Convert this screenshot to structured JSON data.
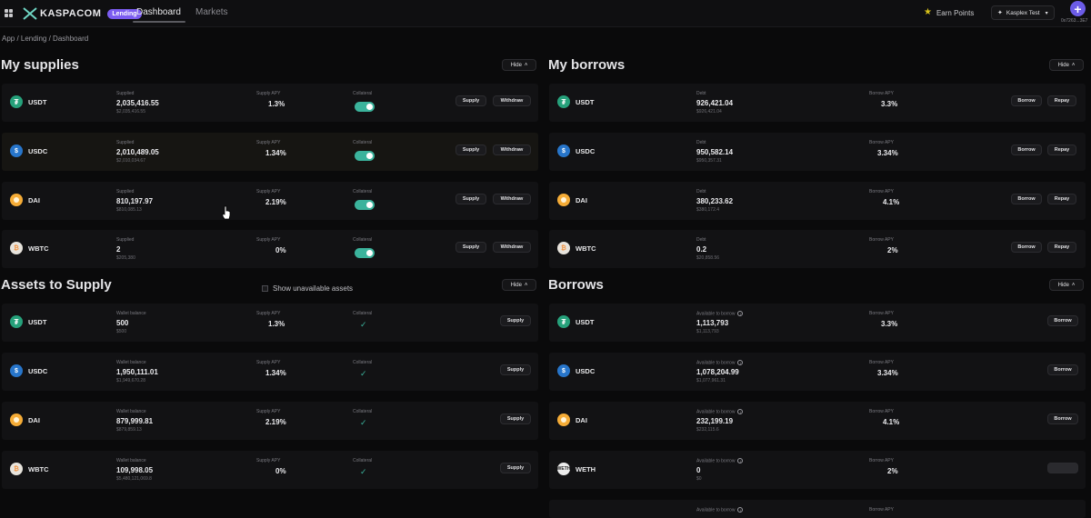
{
  "nav": {
    "brand": "KASPACOM",
    "badge": "Lending",
    "tabs": [
      {
        "label": "Dashboard"
      },
      {
        "label": "Markets"
      }
    ],
    "earn_label": "Earn Points",
    "wallet_label": "Kasplex Test",
    "address": "0x7263...3E7"
  },
  "breadcrumb": "App  /  Lending  /  Dashboard",
  "hide_label": "Hide",
  "supplies": {
    "title": "My supplies",
    "label_supplied": "Supplied",
    "label_apy": "Supply APY",
    "label_collateral": "Collateral",
    "supply_btn": "Supply",
    "withdraw_btn": "Withdraw",
    "rows": [
      {
        "symbol": "USDT",
        "amount": "2,035,416.55",
        "usd": "$2,035,416.55",
        "apy": "1.3%"
      },
      {
        "symbol": "USDC",
        "amount": "2,010,489.05",
        "usd": "$2,010,034.67",
        "apy": "1.34%"
      },
      {
        "symbol": "DAI",
        "amount": "810,197.97",
        "usd": "$810,085.13",
        "apy": "2.19%"
      },
      {
        "symbol": "WBTC",
        "amount": "2",
        "usd": "$205,380",
        "apy": "0%"
      }
    ]
  },
  "borrows_mine": {
    "title": "My borrows",
    "label_debt": "Debt",
    "label_apy": "Borrow APY",
    "borrow_btn": "Borrow",
    "repay_btn": "Repay",
    "rows": [
      {
        "symbol": "USDT",
        "amount": "926,421.04",
        "usd": "$926,421.04",
        "apy": "3.3%"
      },
      {
        "symbol": "USDC",
        "amount": "950,582.14",
        "usd": "$950,357.31",
        "apy": "3.34%"
      },
      {
        "symbol": "DAI",
        "amount": "380,233.62",
        "usd": "$380,172.4",
        "apy": "4.1%"
      },
      {
        "symbol": "WBTC",
        "amount": "0.2",
        "usd": "$20,858.56",
        "apy": "2%"
      }
    ]
  },
  "assets_supply": {
    "title": "Assets to Supply",
    "show_unavailable": "Show unavailable assets",
    "label_balance": "Wallet balance",
    "label_apy": "Supply APY",
    "label_collateral": "Collateral",
    "supply_btn": "Supply",
    "check_icon": "check-icon",
    "rows": [
      {
        "symbol": "USDT",
        "amount": "500",
        "usd": "$500",
        "apy": "1.3%"
      },
      {
        "symbol": "USDC",
        "amount": "1,950,111.01",
        "usd": "$1,949,670.28",
        "apy": "1.34%"
      },
      {
        "symbol": "DAI",
        "amount": "879,999.81",
        "usd": "$879,859.13",
        "apy": "2.19%"
      },
      {
        "symbol": "WBTC",
        "amount": "109,998.05",
        "usd": "$5,480,121,069.8",
        "apy": "0%"
      }
    ]
  },
  "borrows": {
    "title": "Borrows",
    "label_available": "Available to borrow",
    "label_apy": "Borrow APY",
    "borrow_btn": "Borrow",
    "rows": [
      {
        "symbol": "USDT",
        "amount": "1,113,793",
        "usd": "$1,113,793",
        "apy": "3.3%"
      },
      {
        "symbol": "USDC",
        "amount": "1,078,204.99",
        "usd": "$1,077,961.31",
        "apy": "3.34%"
      },
      {
        "symbol": "DAI",
        "amount": "232,199.19",
        "usd": "$232,115.6",
        "apy": "4.1%"
      },
      {
        "symbol": "WETH",
        "amount": "0",
        "usd": "$0",
        "apy": "2%"
      }
    ]
  },
  "colors": {
    "accent": "#3bb39c",
    "brand": "#7b5cf0",
    "plus": "#6c5ce7"
  }
}
